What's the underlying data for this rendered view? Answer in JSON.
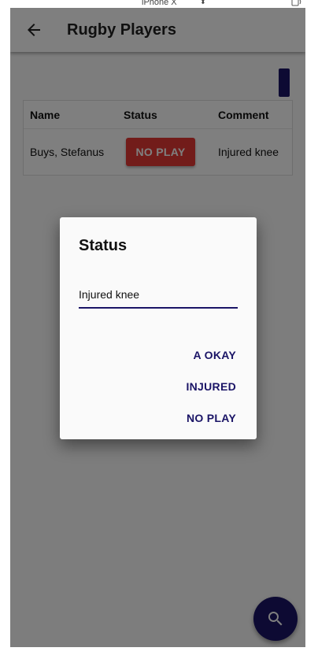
{
  "devtools": {
    "device_name": "iPhone X",
    "device_selector_arrows": "⬍",
    "rotate_icon": "rotate-device-icon"
  },
  "appbar": {
    "title": "Rugby Players",
    "back_icon": "arrow-back-icon"
  },
  "table": {
    "headers": [
      "Name",
      "Status",
      "Comment"
    ],
    "rows": [
      {
        "name": "Buys, Stefanus",
        "status": "NO PLAY",
        "comment": "Injured knee"
      }
    ]
  },
  "dialog": {
    "title": "Status",
    "input_value": "Injured knee",
    "options": [
      "A OKAY",
      "INJURED",
      "NO PLAY"
    ]
  },
  "fab": {
    "icon": "search-icon"
  },
  "colors": {
    "primary": "#1a1466",
    "status_no_play": "#e53935",
    "scrim": "rgba(0,0,0,0.5)"
  }
}
